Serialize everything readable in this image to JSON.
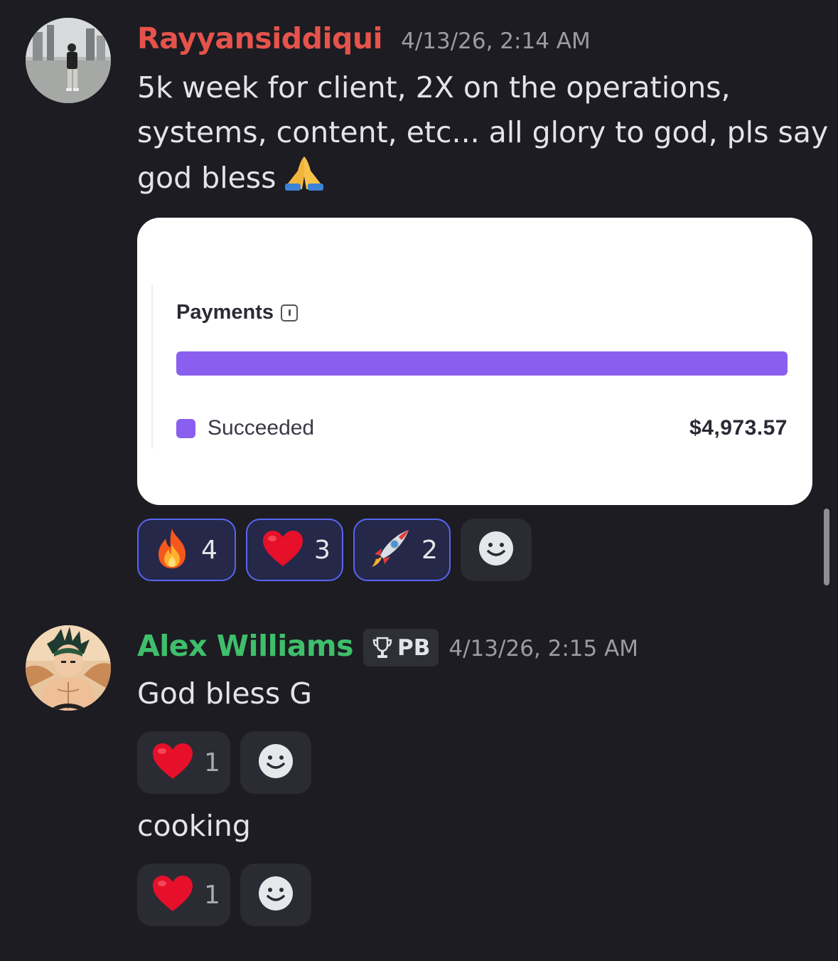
{
  "messages": [
    {
      "author": "Rayyansiddiqui",
      "author_color": "#e5534b",
      "timestamp": "4/13/26, 2:14 AM",
      "lines": [
        "5k week for client, 2X on the operations,",
        "systems, content, etc...  all glory to god, pls say",
        "god bless"
      ],
      "attachment": {
        "title": "Payments",
        "progress_fraction": 1.0,
        "legend_label": "Succeeded",
        "amount": "$4,973.57"
      },
      "reactions": [
        {
          "emoji": "fire-icon",
          "count": "4"
        },
        {
          "emoji": "heart-icon",
          "count": "3"
        },
        {
          "emoji": "rocket-icon",
          "count": "2"
        }
      ]
    },
    {
      "author": "Alex Williams",
      "author_color": "#3fbf6b",
      "badge": "PB",
      "timestamp": "4/13/26, 2:15 AM",
      "text": "God bless G",
      "reactions": [
        {
          "emoji": "heart-icon",
          "count": "1"
        }
      ]
    },
    {
      "text": "cooking",
      "reactions": [
        {
          "emoji": "heart-icon",
          "count": "1"
        }
      ]
    }
  ]
}
